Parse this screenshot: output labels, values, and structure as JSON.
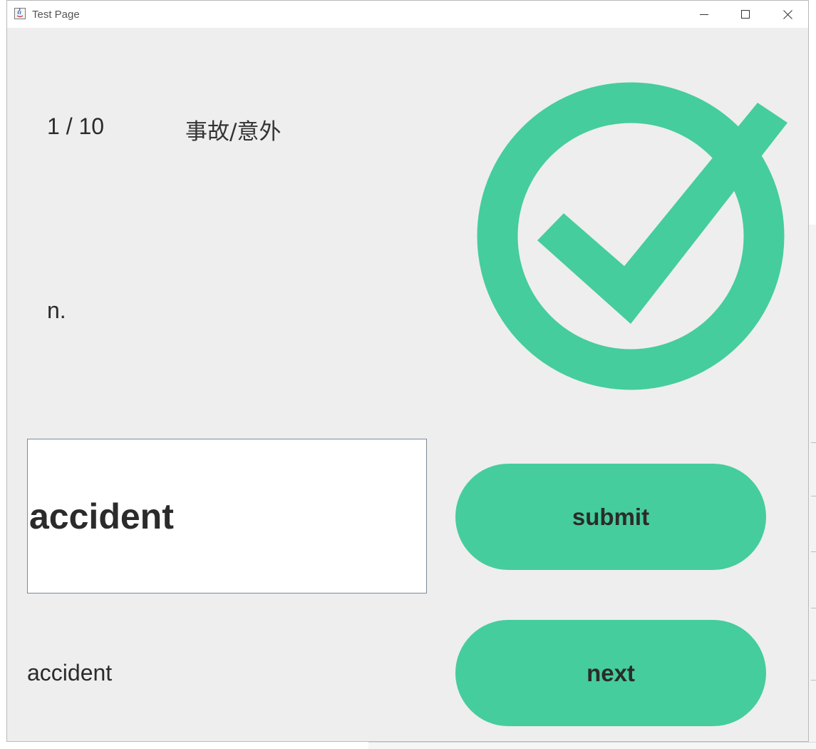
{
  "window": {
    "title": "Test Page",
    "controls": {
      "minimize_icon": "minimize-icon",
      "maximize_icon": "maximize-icon",
      "close_icon": "close-icon"
    }
  },
  "quiz": {
    "counter": "1 / 10",
    "meaning": "事故/意外",
    "part_of_speech": "n.",
    "answer_value": "accident",
    "correct_answer": "accident",
    "result_icon": "check-circle-icon"
  },
  "buttons": {
    "submit_label": "submit",
    "next_label": "next"
  },
  "colors": {
    "accent": "#45cd9d",
    "background": "#eeeeee",
    "text": "#2b2b2b"
  }
}
